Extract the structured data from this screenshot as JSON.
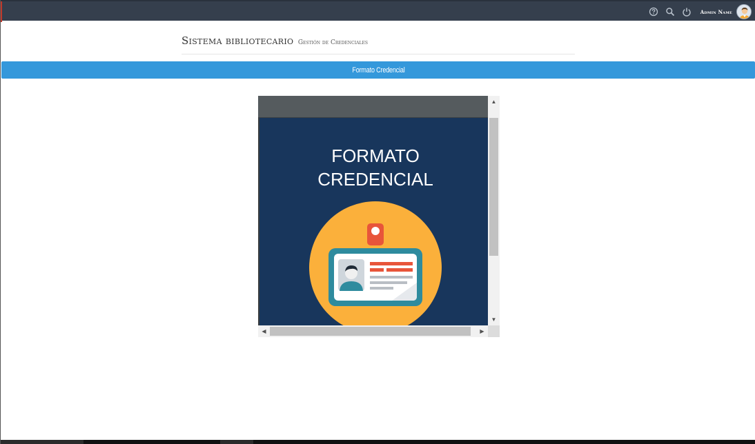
{
  "topbar": {
    "admin_name": "Admin Name",
    "icons": [
      "help-circle-icon",
      "search-icon",
      "power-icon"
    ],
    "colors": {
      "background": "#353f4d",
      "text": "#ffffff"
    }
  },
  "header": {
    "title": "Sistema bibliotecario",
    "subtitle": "Gestión de Credenciales"
  },
  "section_bar": {
    "label": "Formato Credencial",
    "color": "#3498db"
  },
  "preview": {
    "title_line1": "FORMATO",
    "title_line2": "CREDENCIAL",
    "colors": {
      "background": "#18365c",
      "circle": "#fbb03b",
      "card_border": "#2e8b9e",
      "accent": "#e8553a"
    }
  }
}
